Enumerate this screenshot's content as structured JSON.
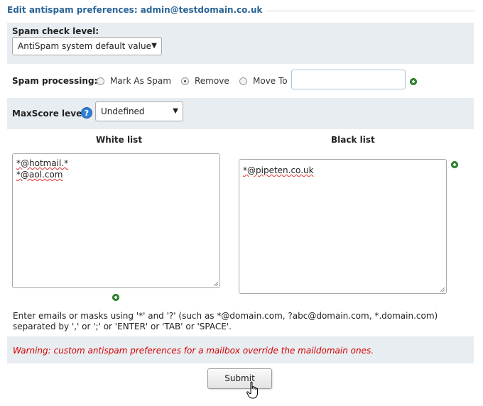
{
  "legend": {
    "title": "Edit antispam preferences: admin@testdomain.co.uk"
  },
  "spam_check": {
    "label": "Spam check level:",
    "selected": "AntiSpam system default value"
  },
  "spam_processing": {
    "label": "Spam processing:",
    "options": [
      "Mark As Spam",
      "Remove",
      "Move To"
    ],
    "selected": "Remove",
    "move_to_value": ""
  },
  "maxscore": {
    "label": "MaxScore level:",
    "help_icon": "help-icon",
    "help_glyph": "?",
    "selected": "Undefined"
  },
  "lists": {
    "white": {
      "title": "White list",
      "entries": [
        "*@hotmail.*",
        "*@aol.com"
      ]
    },
    "black": {
      "title": "Black list",
      "entries": [
        "*@pipeten.co.uk"
      ]
    }
  },
  "hint": "Enter emails or masks using '*' and '?' (such as *@domain.com, ?abc@domain.com, *.domain.com) separated by ',' or ';' or 'ENTER' or 'TAB' or 'SPACE'.",
  "warning": "Warning: custom antispam preferences for a mailbox override the maildomain ones.",
  "submit_label": "Submit",
  "colors": {
    "accent": "#2a6496",
    "row_gray": "#e8edf1",
    "warning": "#d40000",
    "plus_green": "#2f8f2f"
  }
}
